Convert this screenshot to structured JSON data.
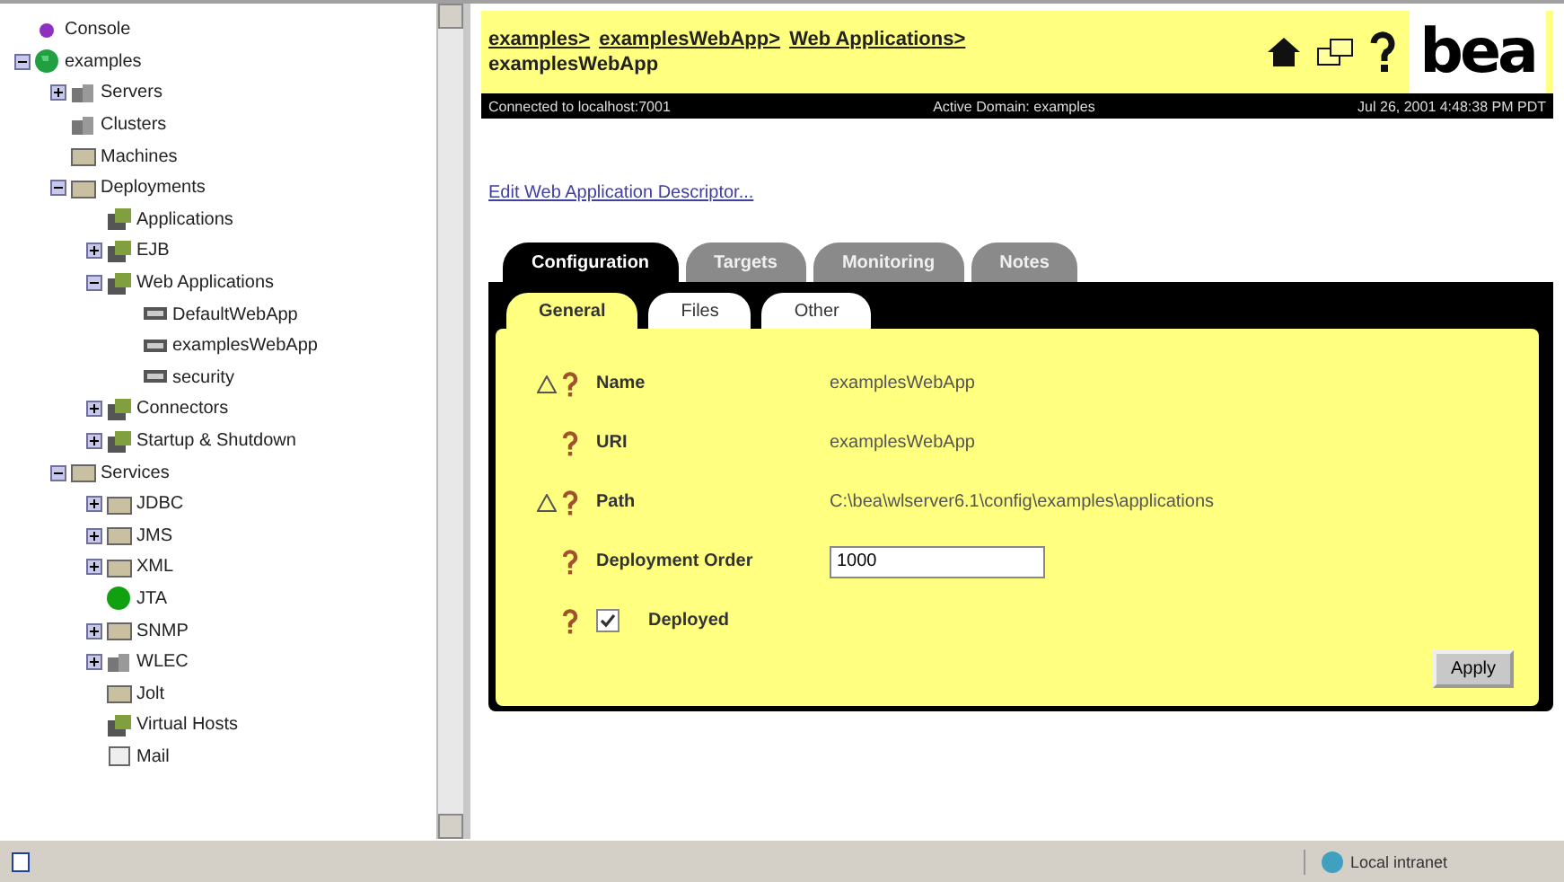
{
  "tree": [
    {
      "label": "Console",
      "kind": "dot"
    },
    {
      "label": "examples",
      "kind": "globe",
      "expanded": true,
      "children": [
        {
          "label": "Servers",
          "kind": "servers",
          "expanded": false
        },
        {
          "label": "Clusters",
          "kind": "servers"
        },
        {
          "label": "Machines",
          "kind": "folder"
        },
        {
          "label": "Deployments",
          "kind": "folder",
          "expanded": true,
          "children": [
            {
              "label": "Applications",
              "kind": "app"
            },
            {
              "label": "EJB",
              "kind": "app",
              "expanded": false
            },
            {
              "label": "Web Applications",
              "kind": "app",
              "expanded": true,
              "children": [
                {
                  "label": "DefaultWebApp",
                  "kind": "module"
                },
                {
                  "label": "examplesWebApp",
                  "kind": "module"
                },
                {
                  "label": "security",
                  "kind": "module"
                }
              ]
            },
            {
              "label": "Connectors",
              "kind": "app",
              "expanded": false
            },
            {
              "label": "Startup & Shutdown",
              "kind": "app",
              "expanded": false
            }
          ]
        },
        {
          "label": "Services",
          "kind": "folder",
          "expanded": true,
          "children": [
            {
              "label": "JDBC",
              "kind": "folder",
              "expanded": false
            },
            {
              "label": "JMS",
              "kind": "folder",
              "expanded": false
            },
            {
              "label": "XML",
              "kind": "folder",
              "expanded": false
            },
            {
              "label": "JTA",
              "kind": "ball"
            },
            {
              "label": "SNMP",
              "kind": "folder",
              "expanded": false
            },
            {
              "label": "WLEC",
              "kind": "servers",
              "expanded": false
            },
            {
              "label": "Jolt",
              "kind": "folder"
            },
            {
              "label": "Virtual Hosts",
              "kind": "app"
            },
            {
              "label": "Mail",
              "kind": "doc"
            }
          ]
        }
      ]
    }
  ],
  "breadcrumb": [
    "examples>",
    "examplesWebApp>",
    "Web Applications>"
  ],
  "page_title": "examplesWebApp",
  "logo": "bea",
  "info_bar": [
    "Connected to localhost:7001",
    "Active Domain: examples",
    "Jul 26, 2001 4:48:38 PM PDT"
  ],
  "edit_link": "Edit Web Application Descriptor...",
  "tabs": [
    {
      "label": "Configuration",
      "selected": true
    },
    {
      "label": "Targets",
      "selected": false
    },
    {
      "label": "Monitoring",
      "selected": false
    },
    {
      "label": "Notes",
      "selected": false
    }
  ],
  "subtabs": [
    {
      "label": "General",
      "selected": true
    },
    {
      "label": "Files",
      "selected": false
    },
    {
      "label": "Other",
      "selected": false
    }
  ],
  "fields": [
    {
      "kind": "text",
      "label": "Name",
      "warning": true,
      "value": "examplesWebApp"
    },
    {
      "kind": "text",
      "label": "URI",
      "warning": false,
      "value": "examplesWebApp"
    },
    {
      "kind": "text",
      "label": "Path",
      "warning": true,
      "value": "C:\\bea\\wlserver6.1\\config\\examples\\applications"
    },
    {
      "kind": "input",
      "label": "Deployment Order",
      "warning": false,
      "value": "1000"
    },
    {
      "kind": "checkbox",
      "label": "Deployed",
      "warning": false,
      "checked": true
    }
  ],
  "apply_button": "Apply",
  "status_bar": {
    "zone": "Local intranet"
  }
}
